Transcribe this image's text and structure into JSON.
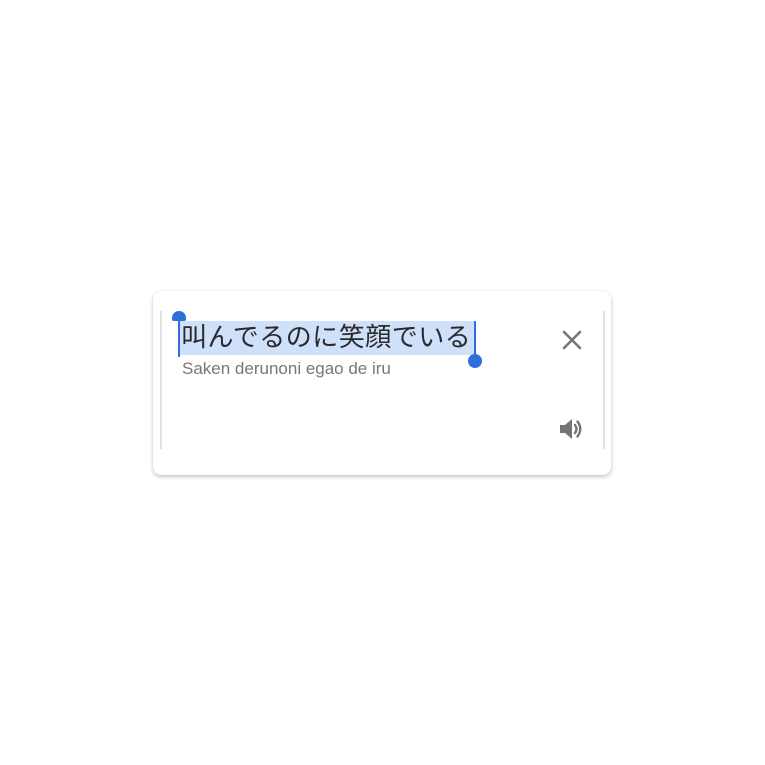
{
  "translation_card": {
    "source_text": "叫んでるのに笑顔でいる",
    "transliteration": "Saken derunoni egao de iru",
    "close_icon": "close-icon",
    "speaker_icon": "speaker-icon"
  },
  "colors": {
    "selection_highlight": "#cfe0fb",
    "selection_handle": "#2f6fdb",
    "icon_gray": "#757575",
    "romaji_gray": "#777777"
  }
}
